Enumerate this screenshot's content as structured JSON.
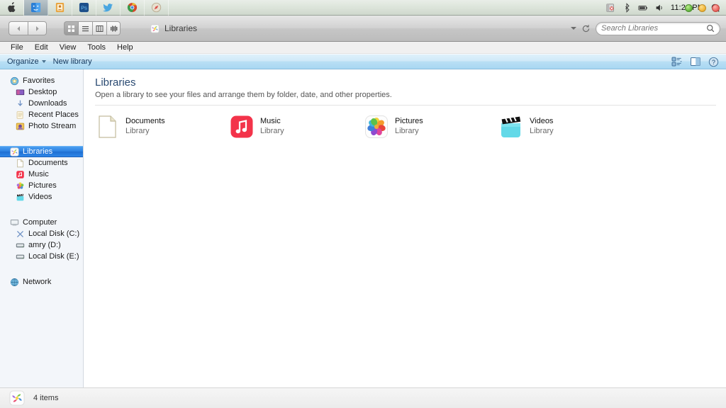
{
  "macbar": {
    "apps": [
      {
        "name": "apple-menu-icon"
      },
      {
        "name": "finder-icon"
      },
      {
        "name": "explorer-app-icon"
      },
      {
        "name": "contacts-icon"
      },
      {
        "name": "photoshop-icon"
      },
      {
        "name": "twitter-icon"
      },
      {
        "name": "chrome-icon"
      },
      {
        "name": "safari-icon"
      }
    ],
    "status_icons": [
      "notification-icon",
      "bluetooth-icon",
      "battery-icon",
      "volume-icon"
    ],
    "clock": "11:21 PM",
    "spotlight": "search-icon"
  },
  "window": {
    "title": "Libraries",
    "title_icon": "libraries-icon",
    "controls": {
      "close": "close-button",
      "minimize": "minimize-button",
      "zoom": "zoom-button"
    },
    "nav": {
      "back": "back-button",
      "forward": "forward-button"
    },
    "view_modes": [
      {
        "name": "icon-view-button",
        "selected": true
      },
      {
        "name": "list-view-button",
        "selected": false
      },
      {
        "name": "column-view-button",
        "selected": false
      },
      {
        "name": "coverflow-view-button",
        "selected": false
      }
    ],
    "toolbar_right": {
      "history_dropdown": "chevron-down-icon",
      "refresh": "refresh-icon"
    },
    "search": {
      "placeholder": "Search Libraries",
      "value": "",
      "icon": "search-icon"
    }
  },
  "menubar": {
    "items": [
      "File",
      "Edit",
      "View",
      "Tools",
      "Help"
    ]
  },
  "commandbar": {
    "organize_label": "Organize",
    "new_library_label": "New library",
    "right_icons": [
      "change-view-icon",
      "preview-pane-icon",
      "help-icon"
    ]
  },
  "sidebar": {
    "groups": [
      {
        "header": {
          "label": "Favorites",
          "icon": "favorites-star-icon"
        },
        "items": [
          {
            "label": "Desktop",
            "icon": "desktop-icon"
          },
          {
            "label": "Downloads",
            "icon": "downloads-icon"
          },
          {
            "label": "Recent Places",
            "icon": "recent-places-icon"
          },
          {
            "label": "Photo Stream",
            "icon": "photo-stream-icon"
          }
        ]
      },
      {
        "header": {
          "label": "Libraries",
          "icon": "libraries-icon",
          "selected": true
        },
        "items": [
          {
            "label": "Documents",
            "icon": "documents-library-icon"
          },
          {
            "label": "Music",
            "icon": "music-library-icon"
          },
          {
            "label": "Pictures",
            "icon": "pictures-library-icon"
          },
          {
            "label": "Videos",
            "icon": "videos-library-icon"
          }
        ]
      },
      {
        "header": {
          "label": "Computer",
          "icon": "computer-icon"
        },
        "items": [
          {
            "label": "Local Disk (C:)",
            "icon": "system-drive-icon"
          },
          {
            "label": "amry (D:)",
            "icon": "drive-icon"
          },
          {
            "label": "Local Disk (E:)",
            "icon": "drive-icon"
          }
        ]
      },
      {
        "header": {
          "label": "Network",
          "icon": "network-icon"
        },
        "items": []
      }
    ]
  },
  "content": {
    "title": "Libraries",
    "subtitle": "Open a library to see your files and arrange them by folder, date, and other properties.",
    "items": [
      {
        "name": "Documents",
        "sub": "Library",
        "icon": "documents-library-icon"
      },
      {
        "name": "Music",
        "sub": "Library",
        "icon": "music-library-icon"
      },
      {
        "name": "Pictures",
        "sub": "Library",
        "icon": "pictures-library-icon"
      },
      {
        "name": "Videos",
        "sub": "Library",
        "icon": "videos-library-icon"
      }
    ]
  },
  "statusbar": {
    "icon": "libraries-icon",
    "count_text": "4 items"
  },
  "colors": {
    "selection_blue": "#2b7fe0",
    "title_blue": "#2a4a72",
    "music_red": "#f3334a",
    "videos_cyan": "#63d9e8"
  }
}
